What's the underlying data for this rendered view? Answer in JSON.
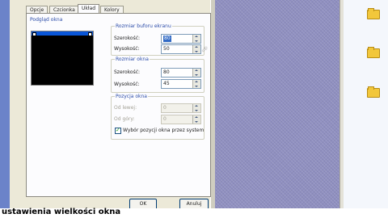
{
  "tabs": [
    "Opcje",
    "Czcionka",
    "Układ",
    "Kolory"
  ],
  "active_tab": "Układ",
  "preview_group": {
    "title": "Podgląd okna"
  },
  "buffer_group": {
    "title": "Rozmiar buforu ekranu",
    "width_label": "Szerokość:",
    "width_value": "80",
    "height_label": "Wysokość:",
    "height_value": "50"
  },
  "window_size_group": {
    "title": "Rozmiar okna",
    "width_label": "Szerokość:",
    "width_value": "80",
    "height_label": "Wysokość:",
    "height_value": "45"
  },
  "position_group": {
    "title": "Pozycja okna",
    "left_label": "Od lewej:",
    "left_value": "0",
    "top_label": "Od góry:",
    "top_value": "0",
    "auto_position_label": "Wybór pozycji okna przez system",
    "auto_position_checked": true
  },
  "buttons": {
    "ok": "OK",
    "cancel": "Anuluj"
  },
  "desktop_folders": [
    "",
    "",
    ""
  ],
  "caption": "ustawienia wielkości okna",
  "colors": {
    "desktop": "#8f8fc0",
    "selection": "#316ac5",
    "group_title": "#2a4ba8"
  }
}
